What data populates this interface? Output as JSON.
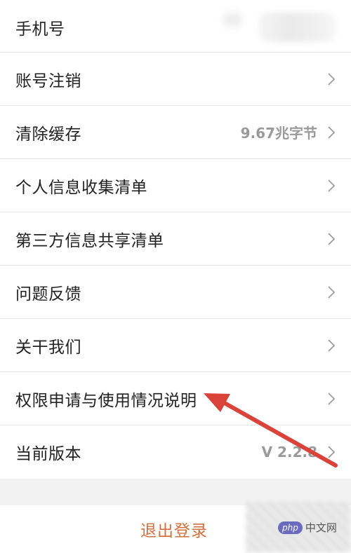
{
  "settings_list": {
    "items": [
      {
        "label": "手机号",
        "value": "",
        "has_chevron": false
      },
      {
        "label": "账号注销",
        "value": "",
        "has_chevron": true
      },
      {
        "label": "清除缓存",
        "value": "9.67兆字节",
        "has_chevron": true
      },
      {
        "label": "个人信息收集清单",
        "value": "",
        "has_chevron": true
      },
      {
        "label": "第三方信息共享清单",
        "value": "",
        "has_chevron": true
      },
      {
        "label": "问题反馈",
        "value": "",
        "has_chevron": true
      },
      {
        "label": "关干我们",
        "value": "",
        "has_chevron": true
      },
      {
        "label": "权限申请与使用情况说明",
        "value": "",
        "has_chevron": true
      },
      {
        "label": "当前版本",
        "value": "V 2.2.8",
        "has_chevron": true
      }
    ]
  },
  "logout": {
    "label": "退出登录"
  },
  "watermark": {
    "badge": "php",
    "text": "中文网"
  },
  "icons": {
    "row_chevron": "chevron-right-icon",
    "annotation": "red-arrow-annotation"
  },
  "colors": {
    "logout_text": "#d2703f",
    "annotation_arrow": "#d9433a",
    "value_text": "#9a9a9a"
  }
}
